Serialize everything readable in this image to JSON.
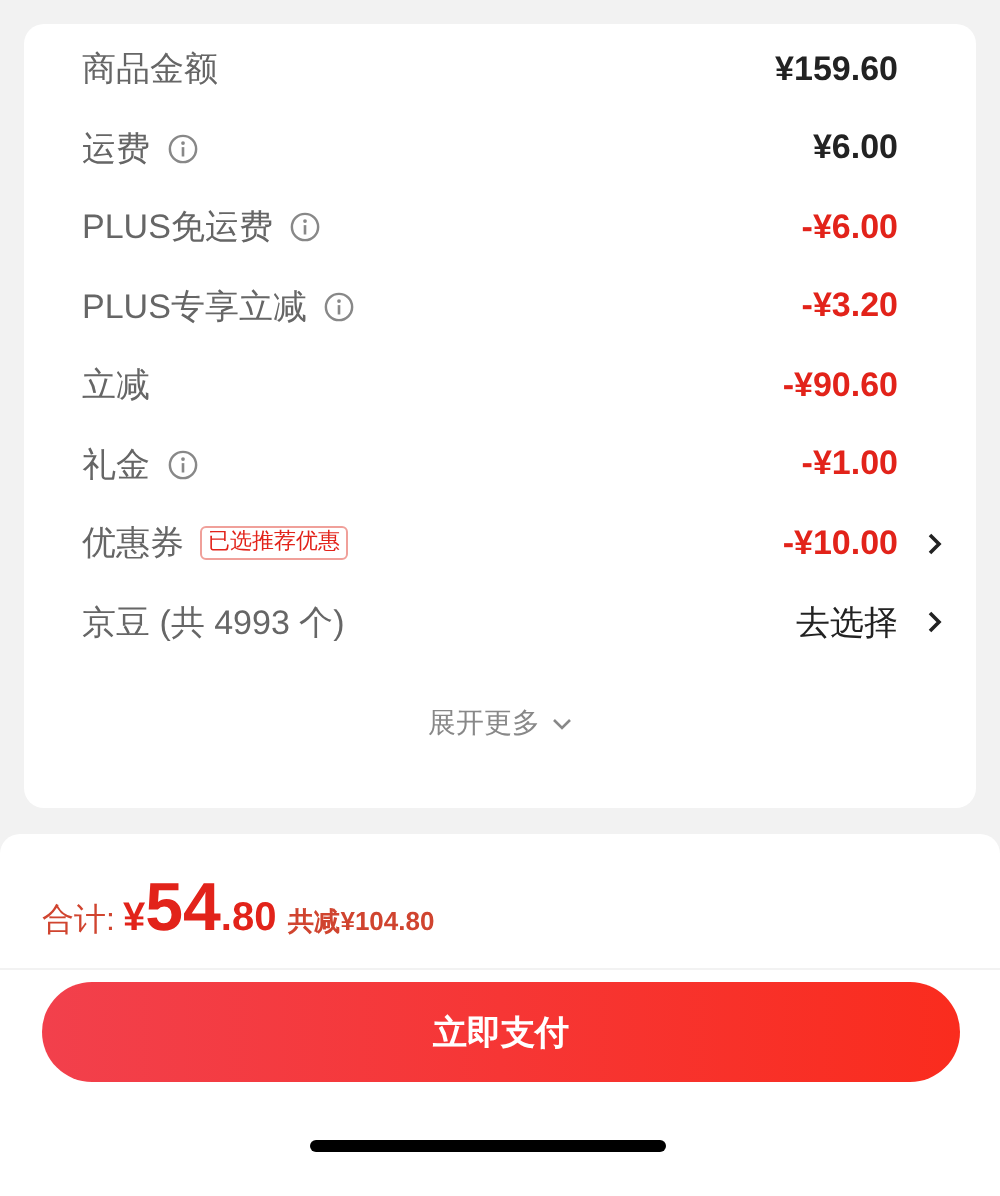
{
  "summary": {
    "rows": [
      {
        "label": "商品金额",
        "info": false,
        "value": "¥159.60",
        "kind": "normal",
        "chevron": false
      },
      {
        "label": "运费",
        "info": true,
        "value": "¥6.00",
        "kind": "normal",
        "chevron": false
      },
      {
        "label": "PLUS免运费",
        "info": true,
        "value": "-¥6.00",
        "kind": "discount",
        "chevron": false
      },
      {
        "label": "PLUS专享立减",
        "info": true,
        "value": "-¥3.20",
        "kind": "discount",
        "chevron": false
      },
      {
        "label": "立减",
        "info": false,
        "value": "-¥90.60",
        "kind": "discount",
        "chevron": false
      },
      {
        "label": "礼金",
        "info": true,
        "value": "-¥1.00",
        "kind": "discount",
        "chevron": false
      },
      {
        "label": "优惠券",
        "info": false,
        "tag": "已选推荐优惠",
        "value": "-¥10.00",
        "kind": "discount",
        "chevron": true
      },
      {
        "label": "京豆 (共 4993 个)",
        "info": false,
        "value": "去选择",
        "kind": "normal",
        "chevron": true
      }
    ],
    "expand": "展开更多"
  },
  "total": {
    "label": "合计:",
    "currency": "¥",
    "integer": "54",
    "decimal": ".80",
    "saved": "共减¥104.80"
  },
  "pay_button": "立即支付"
}
